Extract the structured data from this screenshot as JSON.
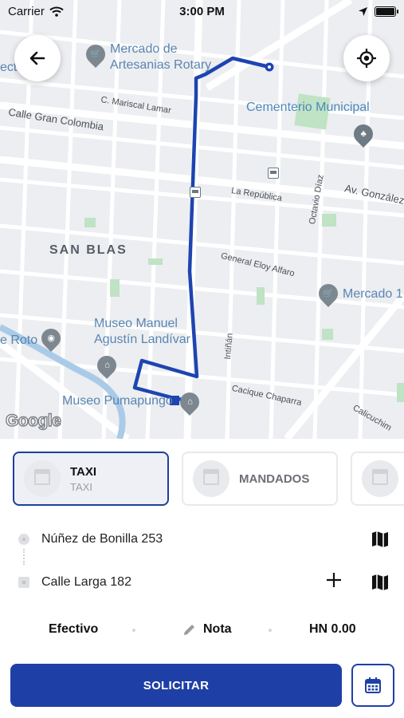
{
  "status_bar": {
    "carrier": "Carrier",
    "time": "3:00 PM",
    "battery_level": 1.0
  },
  "map": {
    "labels": {
      "mercado_artesanias": "Mercado de\nArtesanias Rotary",
      "cementerio": "Cementerio Municipal",
      "mariscal_lamar": "C. Mariscal Lamar",
      "gran_colombia": "Calle Gran Colombia",
      "la_republica": "La República",
      "av_gonzalez": "Av. González",
      "san_blas": "SAN BLAS",
      "octavio_diaz": "Octavio Díaz",
      "general_eloy_alfaro": "General Eloy Alfaro",
      "mercado_1": "Mercado 1",
      "museo_landivar": "Museo Manuel\nAgustín Landívar",
      "roto": "e Roto",
      "museo_pumapungo": "Museo Pumapungo",
      "intinan": "Intiñán",
      "cacique_chaparra": "Cacique Chaparra",
      "calicuchima": "Calicuchim",
      "ecta": "ecta",
      "google": "Google"
    },
    "route_color": "#1e44b0",
    "back_icon": "arrow-left-icon",
    "locate_icon": "crosshair-icon"
  },
  "services": [
    {
      "title": "TAXI",
      "subtitle": "TAXI",
      "selected": true,
      "icon": "store-icon"
    },
    {
      "title": "MANDADOS",
      "subtitle": "",
      "selected": false,
      "icon": "store-icon"
    },
    {
      "title": "",
      "subtitle": "",
      "selected": false,
      "icon": "store-icon"
    }
  ],
  "route": {
    "origin": "Núñez de Bonilla 253",
    "destination": "Calle Larga 182"
  },
  "payment": {
    "method": "Efectivo",
    "note_label": "Nota",
    "amount": "HN 0.00"
  },
  "actions": {
    "request_label": "SOLICITAR",
    "schedule_icon": "calendar-icon"
  },
  "colors": {
    "primary": "#1e40a6",
    "selected_card_bg": "#eef0f5"
  }
}
